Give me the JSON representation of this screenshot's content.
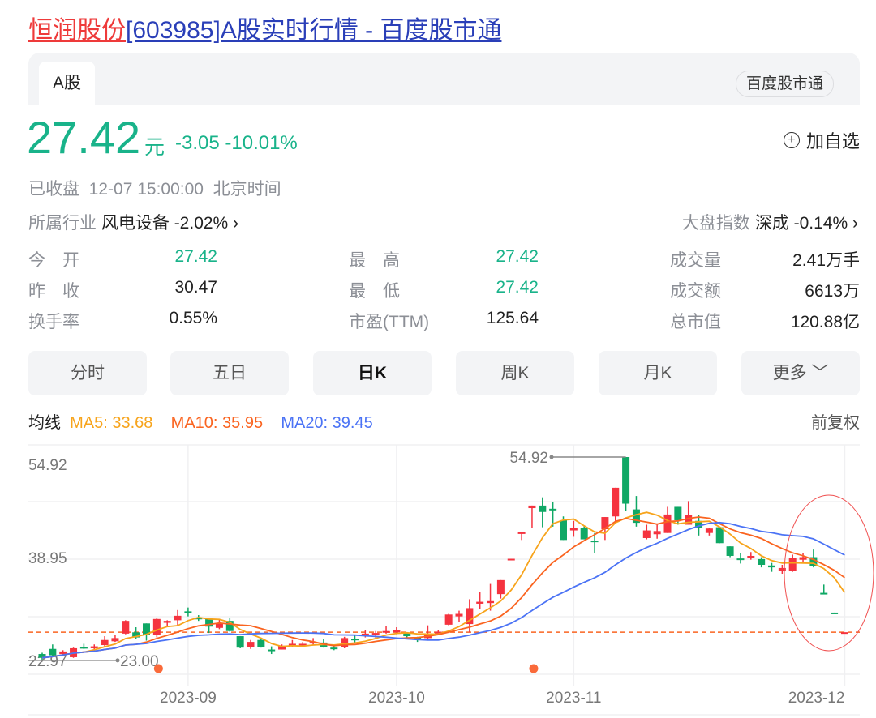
{
  "title": {
    "name": "恒润股份",
    "rest": "[603985]A股实时行情 - 百度股市通"
  },
  "tabs": {
    "active": "A股",
    "source_badge": "百度股市通"
  },
  "quote": {
    "price": "27.42",
    "unit": "元",
    "change": "-3.05",
    "change_pct": "-10.01%",
    "add_watchlist": "加自选"
  },
  "status": {
    "state": "已收盘",
    "time": "12-07 15:00:00",
    "zone": "北京时间"
  },
  "industry": {
    "label": "所属行业",
    "name": "风电设备",
    "change": "-2.02%"
  },
  "market": {
    "label": "大盘指数",
    "name": "深成",
    "change": "-0.14%"
  },
  "stats": [
    {
      "label": "今　开",
      "value": "27.42",
      "color": "green"
    },
    {
      "label": "最　高",
      "value": "27.42",
      "color": "green"
    },
    {
      "label": "成交量",
      "value": "2.41万手",
      "color": "black"
    },
    {
      "label": "昨　收",
      "value": "30.47",
      "color": "black"
    },
    {
      "label": "最　低",
      "value": "27.42",
      "color": "green"
    },
    {
      "label": "成交额",
      "value": "6613万",
      "color": "black"
    },
    {
      "label": "换手率",
      "value": "0.55%",
      "color": "black"
    },
    {
      "label": "市盈(TTM)",
      "value": "125.64",
      "color": "black"
    },
    {
      "label": "总市值",
      "value": "120.88亿",
      "color": "black"
    }
  ],
  "period_buttons": [
    "分时",
    "五日",
    "日K",
    "周K",
    "月K",
    "更多"
  ],
  "active_period": "日K",
  "ma_legend": {
    "label": "均线",
    "ma5": "MA5: 33.68",
    "ma10": "MA10: 35.95",
    "ma20": "MA20: 39.45",
    "adjust": "前复权"
  },
  "colors": {
    "up": "#f5333f",
    "down": "#0fa865",
    "ma5": "#f7a41c",
    "ma10": "#fa6420",
    "ma20": "#4b73f5",
    "accent_green": "#19b38a"
  },
  "chart_data": {
    "type": "candlestick",
    "y_labels": [
      "54.92",
      "38.95",
      "22.97"
    ],
    "ylim": [
      22.97,
      54.92
    ],
    "x_labels": [
      {
        "label": "2023-09",
        "index": 14
      },
      {
        "label": "2023-10",
        "index": 34
      },
      {
        "label": "2023-11",
        "index": 51
      },
      {
        "label": "2023-12",
        "index": 77
      }
    ],
    "high_marker": {
      "label": "54.92",
      "index": 56,
      "value": 54.92
    },
    "low_marker": {
      "label": "23.00",
      "index": 0,
      "value": 23.0
    },
    "last_close_line": 27.42,
    "event_markers": [
      11,
      47
    ],
    "highlight_ellipse_indices": [
      71,
      77
    ],
    "ohlc": [
      [
        24.0,
        24.2,
        23.0,
        23.4
      ],
      [
        24.8,
        25.5,
        23.6,
        23.8
      ],
      [
        24.0,
        24.6,
        23.8,
        24.4
      ],
      [
        23.5,
        25.0,
        23.4,
        24.9
      ],
      [
        25.1,
        25.6,
        24.8,
        25.0
      ],
      [
        24.9,
        25.5,
        24.7,
        25.2
      ],
      [
        25.4,
        26.8,
        25.2,
        26.2
      ],
      [
        26.0,
        27.0,
        25.9,
        26.5
      ],
      [
        27.2,
        29.3,
        27.1,
        29.2
      ],
      [
        27.4,
        28.2,
        26.4,
        26.6
      ],
      [
        28.8,
        28.8,
        26.1,
        27.0
      ],
      [
        27.0,
        29.6,
        26.6,
        29.5
      ],
      [
        28.9,
        29.3,
        28.4,
        29.2
      ],
      [
        29.3,
        30.9,
        28.4,
        30.0
      ],
      [
        30.7,
        31.3,
        29.9,
        30.5
      ],
      [
        29.7,
        30.1,
        29.2,
        29.5
      ],
      [
        29.5,
        29.6,
        27.3,
        28.3
      ],
      [
        28.1,
        29.4,
        27.9,
        28.9
      ],
      [
        29.2,
        29.7,
        27.5,
        27.6
      ],
      [
        26.8,
        26.8,
        24.9,
        25.0
      ],
      [
        25.1,
        26.2,
        24.8,
        25.9
      ],
      [
        26.2,
        26.4,
        25.0,
        25.1
      ],
      [
        24.7,
        25.2,
        24.0,
        24.6
      ],
      [
        24.7,
        25.5,
        24.7,
        25.3
      ],
      [
        25.4,
        26.2,
        25.1,
        25.6
      ],
      [
        25.4,
        25.9,
        25.1,
        25.6
      ],
      [
        25.7,
        26.5,
        25.4,
        25.9
      ],
      [
        25.8,
        26.3,
        25.0,
        25.1
      ],
      [
        25.0,
        25.4,
        24.6,
        24.9
      ],
      [
        25.1,
        26.7,
        24.9,
        26.5
      ],
      [
        26.4,
        27.0,
        25.8,
        26.3
      ],
      [
        27.0,
        27.7,
        26.6,
        27.2
      ],
      [
        27.0,
        27.6,
        26.5,
        27.3
      ],
      [
        27.4,
        28.4,
        27.2,
        27.6
      ],
      [
        27.4,
        28.2,
        27.1,
        27.8
      ],
      [
        27.3,
        27.4,
        26.6,
        26.8
      ],
      [
        26.6,
        26.7,
        25.9,
        26.3
      ],
      [
        26.5,
        28.5,
        26.2,
        27.2
      ],
      [
        27.2,
        27.8,
        27.1,
        27.5
      ],
      [
        28.6,
        30.3,
        28.5,
        30.2
      ],
      [
        29.9,
        30.8,
        29.0,
        30.3
      ],
      [
        28.7,
        32.6,
        27.4,
        31.2
      ],
      [
        31.9,
        33.8,
        31.1,
        32.2
      ],
      [
        32.0,
        35.0,
        30.8,
        32.3
      ],
      [
        33.4,
        35.6,
        32.7,
        35.6
      ],
      [
        38.9,
        38.95,
        38.9,
        38.95
      ],
      [
        42.9,
        43.1,
        41.9,
        43.1
      ],
      [
        46.9,
        47.3,
        43.8,
        47.3
      ],
      [
        47.3,
        48.6,
        43.9,
        46.3
      ],
      [
        46.8,
        47.8,
        44.0,
        46.6
      ],
      [
        45.0,
        45.6,
        41.9,
        41.9
      ],
      [
        43.4,
        44.9,
        42.4,
        43.8
      ],
      [
        43.8,
        44.2,
        42.0,
        42.0
      ],
      [
        41.8,
        43.0,
        39.8,
        41.6
      ],
      [
        43.6,
        45.5,
        41.9,
        45.5
      ],
      [
        45.6,
        50.1,
        44.9,
        50.1
      ],
      [
        54.92,
        54.92,
        46.5,
        47.6
      ],
      [
        46.7,
        48.8,
        44.0,
        44.6
      ],
      [
        42.2,
        44.3,
        42.0,
        43.4
      ],
      [
        42.8,
        44.3,
        42.1,
        43.3
      ],
      [
        43.0,
        47.1,
        43.0,
        45.9
      ],
      [
        47.1,
        47.1,
        44.3,
        45.0
      ],
      [
        44.3,
        48.0,
        44.3,
        45.8
      ],
      [
        44.9,
        45.8,
        42.6,
        43.8
      ],
      [
        43.0,
        43.8,
        42.6,
        43.7
      ],
      [
        43.9,
        43.9,
        41.4,
        41.4
      ],
      [
        40.9,
        40.9,
        39.2,
        39.4
      ],
      [
        39.0,
        39.8,
        38.2,
        38.9
      ],
      [
        39.3,
        40.0,
        38.8,
        39.4
      ],
      [
        38.9,
        39.2,
        37.6,
        38.0
      ],
      [
        37.9,
        38.3,
        36.9,
        37.6
      ],
      [
        37.1,
        38.0,
        36.6,
        37.5
      ],
      [
        37.1,
        39.6,
        36.9,
        39.1
      ],
      [
        38.8,
        39.8,
        38.5,
        39.2
      ],
      [
        39.2,
        40.4,
        37.6,
        37.8
      ],
      [
        33.6,
        34.9,
        33.4,
        33.4
      ],
      [
        30.5,
        30.5,
        30.45,
        30.45
      ],
      [
        27.42,
        27.42,
        27.42,
        27.42
      ]
    ],
    "ma_periods": [
      5,
      10,
      20
    ]
  }
}
